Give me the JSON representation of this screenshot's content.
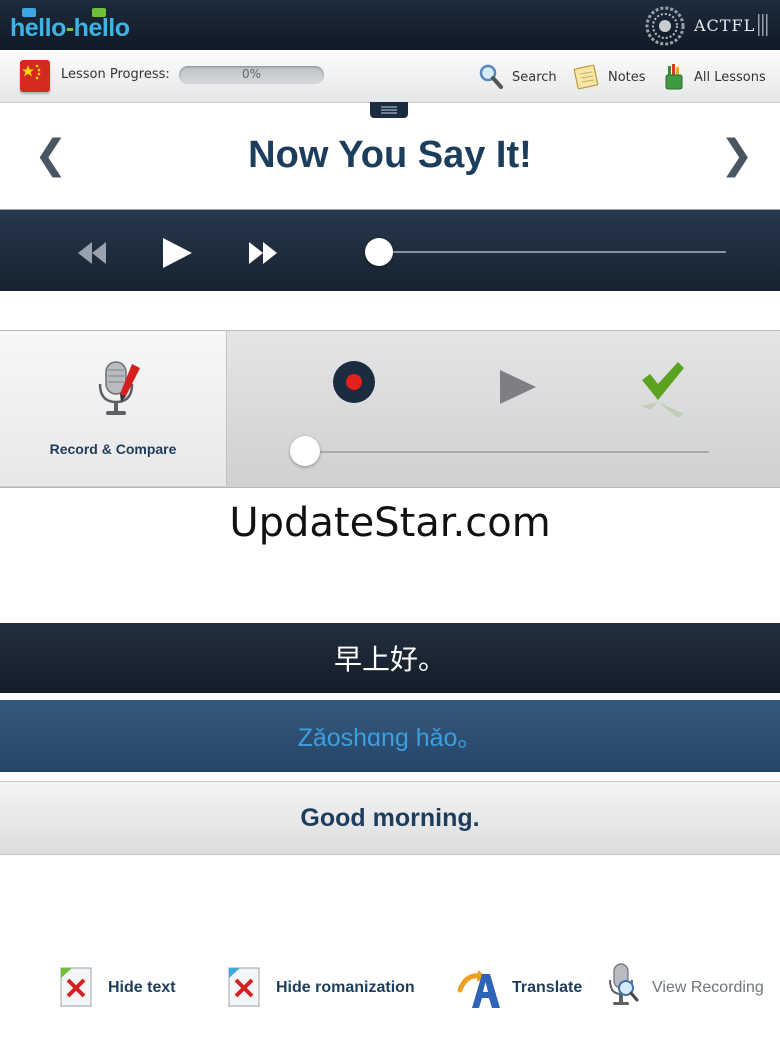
{
  "header": {
    "logo": {
      "left": "hello",
      "dash": "-",
      "right": "hello"
    },
    "partner": "ACTFL"
  },
  "toolbar": {
    "progress_label": "Lesson Progress:",
    "progress_value": "0%",
    "progress_fraction": 0,
    "search_label": "Search",
    "notes_label": "Notes",
    "all_lessons_label": "All Lessons"
  },
  "page": {
    "title": "Now You Say It!",
    "prev_glyph": "❮",
    "next_glyph": "❯"
  },
  "player": {
    "position_fraction": 0
  },
  "record_compare": {
    "label": "Record & Compare",
    "position_fraction": 0
  },
  "watermark": "UpdateStar.com",
  "phrase": {
    "chinese": "早上好。",
    "pinyin": "Zǎoshɑng hǎo。",
    "english": "Good morning."
  },
  "bottom_toolbar": {
    "hide_text_label": "Hide text",
    "hide_romanization_label": "Hide romanization",
    "translate_label": "Translate",
    "view_recording_label": "View Recording"
  },
  "colors": {
    "navy": "#1d3d5c",
    "dark_bar": "#16222f",
    "pinyin_text": "#3b9fe0",
    "record_red": "#e0211c",
    "check_green": "#5aa21f"
  }
}
